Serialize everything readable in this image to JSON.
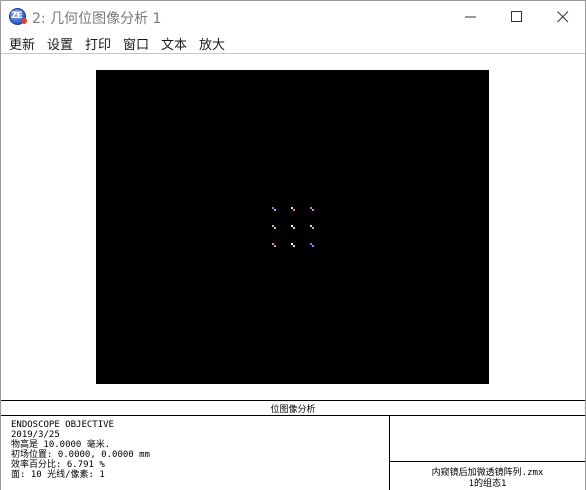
{
  "window": {
    "title": "2: 几何位图像分析 1",
    "icon_name": "zemax-app-icon",
    "controls": [
      "minimize-icon",
      "maximize-icon",
      "close-icon"
    ]
  },
  "menu": {
    "items": [
      "更新",
      "设置",
      "打印",
      "窗口",
      "文本",
      "放大"
    ]
  },
  "plot": {
    "background": "#000000",
    "label": "位图像分析"
  },
  "info": {
    "lines": [
      "ENDOSCOPE OBJECTIVE",
      "2019/3/25",
      "物高是 10.0000 毫米.",
      "初场位置: 0.0000, 0.0000 mm",
      "效率百分比:   6.791 %",
      "面: 10    光线/像素: 1"
    ],
    "file_name": "内窥镜后加微透镜阵列.zmx",
    "config": "1的组态1"
  }
}
